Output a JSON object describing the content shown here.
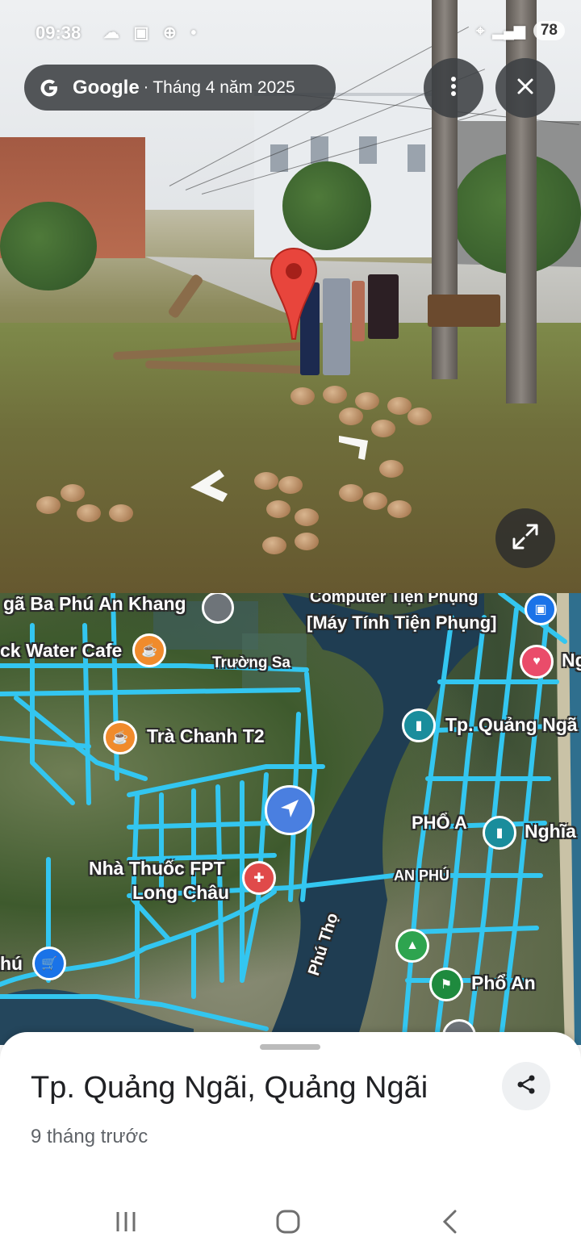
{
  "status_bar": {
    "time": "09:38",
    "left_icons": "☁ ▣ ⊕ •",
    "battery": "78"
  },
  "street_view": {
    "provider": "Google",
    "date": "Tháng 4 năm 2025",
    "separator": "·",
    "icons": {
      "more": "more-vert-icon",
      "close": "close-icon",
      "expand": "expand-icon"
    }
  },
  "map": {
    "labels": {
      "nga_ba": "gã Ba Phú An Khang",
      "computer_en": "Computer Tiện Phụng",
      "computer_vi": "[Máy Tính Tiện Phụng]",
      "water_cafe": "ck Water Cafe",
      "truong_sa": "Trường Sa",
      "tra_chanh": "Trà Chanh T2",
      "tp_qn": "Tp. Quảng Ngã",
      "ng": "Ng",
      "pho_an_caps": "PHỔ A",
      "nghia": "Nghĩa",
      "nha_thuoc_1": "Nhà Thuốc FPT",
      "nha_thuoc_2": "Long Châu",
      "an_phu": "AN PHÚ",
      "phu_tho": "Phú Thọ",
      "pho_an": "Phổ An",
      "hu": "hú"
    },
    "colors": {
      "road": "#33c6f0",
      "cafe": "#f08b2c",
      "pharmacy": "#e04a4a",
      "landmark": "#1a8d9c",
      "park": "#2ea44f",
      "shopping": "#1a73e8",
      "favorite": "#ea4c6a"
    }
  },
  "place": {
    "title": "Tp. Quảng Ngãi, Quảng Ngãi",
    "subtitle": "9 tháng trước"
  },
  "nav_bar": {
    "recents": "recents-icon",
    "home": "home-icon",
    "back": "back-icon"
  }
}
